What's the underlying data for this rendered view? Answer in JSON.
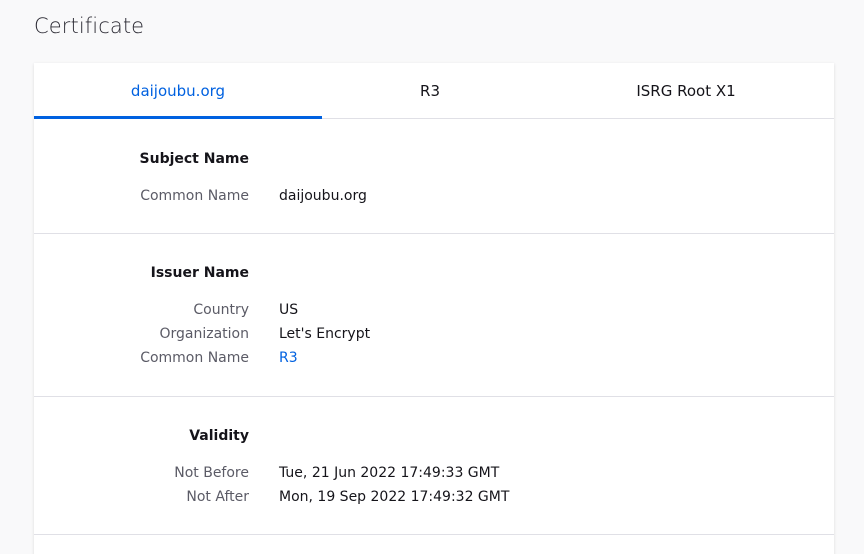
{
  "page": {
    "title": "Certificate"
  },
  "tabs": [
    {
      "label": "daijoubu.org",
      "active": true
    },
    {
      "label": "R3",
      "active": false
    },
    {
      "label": "ISRG Root X1",
      "active": false
    }
  ],
  "sections": {
    "subject": {
      "title": "Subject Name",
      "rows": [
        {
          "label": "Common Name",
          "value": "daijoubu.org"
        }
      ]
    },
    "issuer": {
      "title": "Issuer Name",
      "rows": [
        {
          "label": "Country",
          "value": "US"
        },
        {
          "label": "Organization",
          "value": "Let's Encrypt"
        },
        {
          "label": "Common Name",
          "value": "R3"
        }
      ]
    },
    "validity": {
      "title": "Validity",
      "rows": [
        {
          "label": "Not Before",
          "value": "Tue, 21 Jun 2022 17:49:33 GMT"
        },
        {
          "label": "Not After",
          "value": "Mon, 19 Sep 2022 17:49:32 GMT"
        }
      ]
    }
  },
  "colors": {
    "accent": "#0061e0",
    "label": "#5b5b66",
    "text": "#15141a",
    "divider": "#e0e0e6",
    "background": "#f9f9fa"
  }
}
